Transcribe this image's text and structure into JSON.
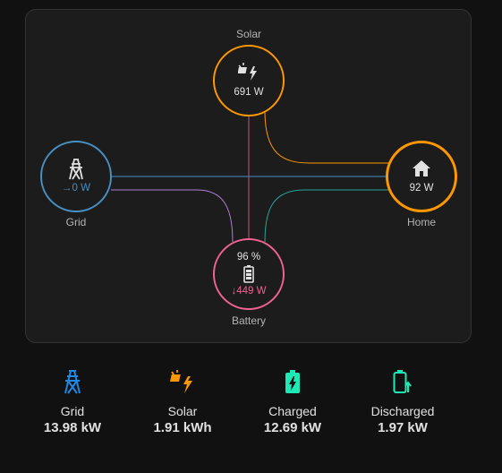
{
  "flow": {
    "solar": {
      "label": "Solar",
      "power": "691 W",
      "icon": "solar-power-icon",
      "color": "#ff9800"
    },
    "grid": {
      "label": "Grid",
      "power": "→0 W",
      "icon": "transmission-tower-icon",
      "color": "#488fc2"
    },
    "home": {
      "label": "Home",
      "power": "92 W",
      "icon": "home-icon",
      "color": "#ff9800"
    },
    "battery": {
      "label": "Battery",
      "percent": "96 %",
      "power": "↓449 W",
      "icon": "battery-icon",
      "color": "#f06292"
    }
  },
  "stats": [
    {
      "name": "Grid",
      "amount": "13.98 kW",
      "icon": "transmission-tower-icon",
      "color": "#1e88e5"
    },
    {
      "name": "Solar",
      "amount": "1.91 kWh",
      "icon": "solar-power-icon",
      "color": "#ff9800"
    },
    {
      "name": "Charged",
      "amount": "12.69 kW",
      "icon": "battery-charging-icon",
      "color": "#1de9b6"
    },
    {
      "name": "Discharged",
      "amount": "1.97 kW",
      "icon": "battery-discharge-icon",
      "color": "#1de9b6"
    }
  ]
}
